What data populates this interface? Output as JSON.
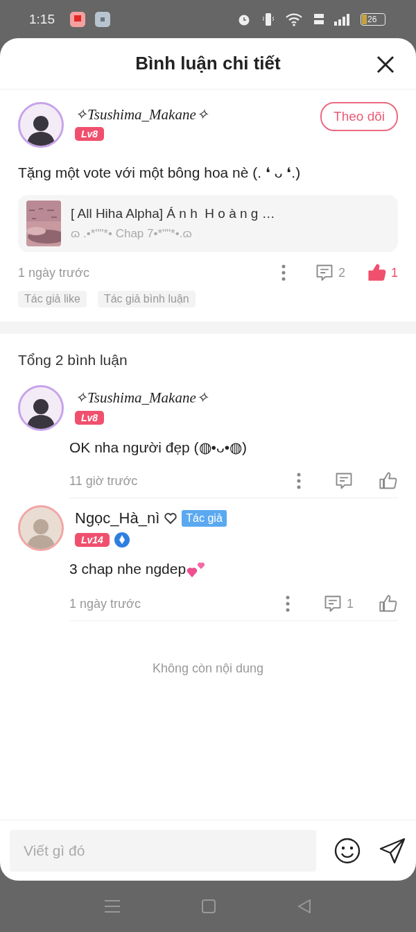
{
  "status_bar": {
    "time": "1:15",
    "battery": "26"
  },
  "header": {
    "title": "Bình luận chi tiết"
  },
  "post": {
    "author": {
      "name": "✧Tsushima_Makane✧",
      "level": "Lv8"
    },
    "follow_button": "Theo dõi",
    "text": "Tặng một vote với một bông hoa nè (. ❛ ᴗ ❛.)",
    "linked_story": {
      "title": "[ All Hiha Alpha] Á n h  H o à n g …",
      "chapter": "ɷ .•*\"\"*• Chap 7•*\"\"*•.ɷ"
    },
    "time": "1 ngày trước",
    "comment_count": "2",
    "like_count": "1",
    "liked": true,
    "tags": [
      "Tác giả like",
      "Tác giả bình luận"
    ]
  },
  "comments_total": "Tổng 2 bình luận",
  "comments": [
    {
      "name": "✧Tsushima_Makane✧",
      "kind": "fancy",
      "level": "Lv8",
      "verified": false,
      "text": "OK nha người đẹp (◍•ᴗ•◍)",
      "hearts": false,
      "time": "11 giờ trước",
      "liked": false
    },
    {
      "name": "Ngọc_Hà_nì",
      "kind": "plain",
      "author_tag": "Tác giả",
      "level": "Lv14",
      "verified": true,
      "text": "3 chap nhe ngdep",
      "hearts": true,
      "time": "1 ngày trước",
      "reply_count": "1",
      "liked": false
    }
  ],
  "end_note": "Không còn nội dung",
  "composer": {
    "placeholder": "Viết gì đó"
  }
}
